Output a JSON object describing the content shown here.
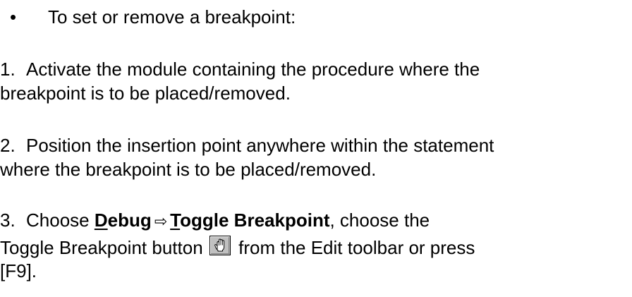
{
  "bullet": {
    "symbol": "•",
    "text": "To set or remove a breakpoint:"
  },
  "steps": [
    {
      "number": "1.",
      "line1": "Activate the module containing the procedure where the",
      "line2": "breakpoint is to be placed/removed."
    },
    {
      "number": "2.",
      "line1": "Position the insertion point anywhere within the statement",
      "line2": "where the breakpoint is to be placed/removed."
    },
    {
      "number": "3.",
      "line1_prefix": "Choose ",
      "menu_debug_first": "D",
      "menu_debug_rest": "ebug",
      "menu_arrow": "⇨",
      "menu_toggle_first": "T",
      "menu_toggle_rest": "oggle Breakpoint",
      "line1_suffix": ", choose the",
      "line2_prefix": "Toggle Breakpoint button",
      "line2_suffix": "from the Edit toolbar or press",
      "line3": "[F9]."
    }
  ],
  "icons": {
    "toggle_breakpoint_button": "hand-icon"
  }
}
